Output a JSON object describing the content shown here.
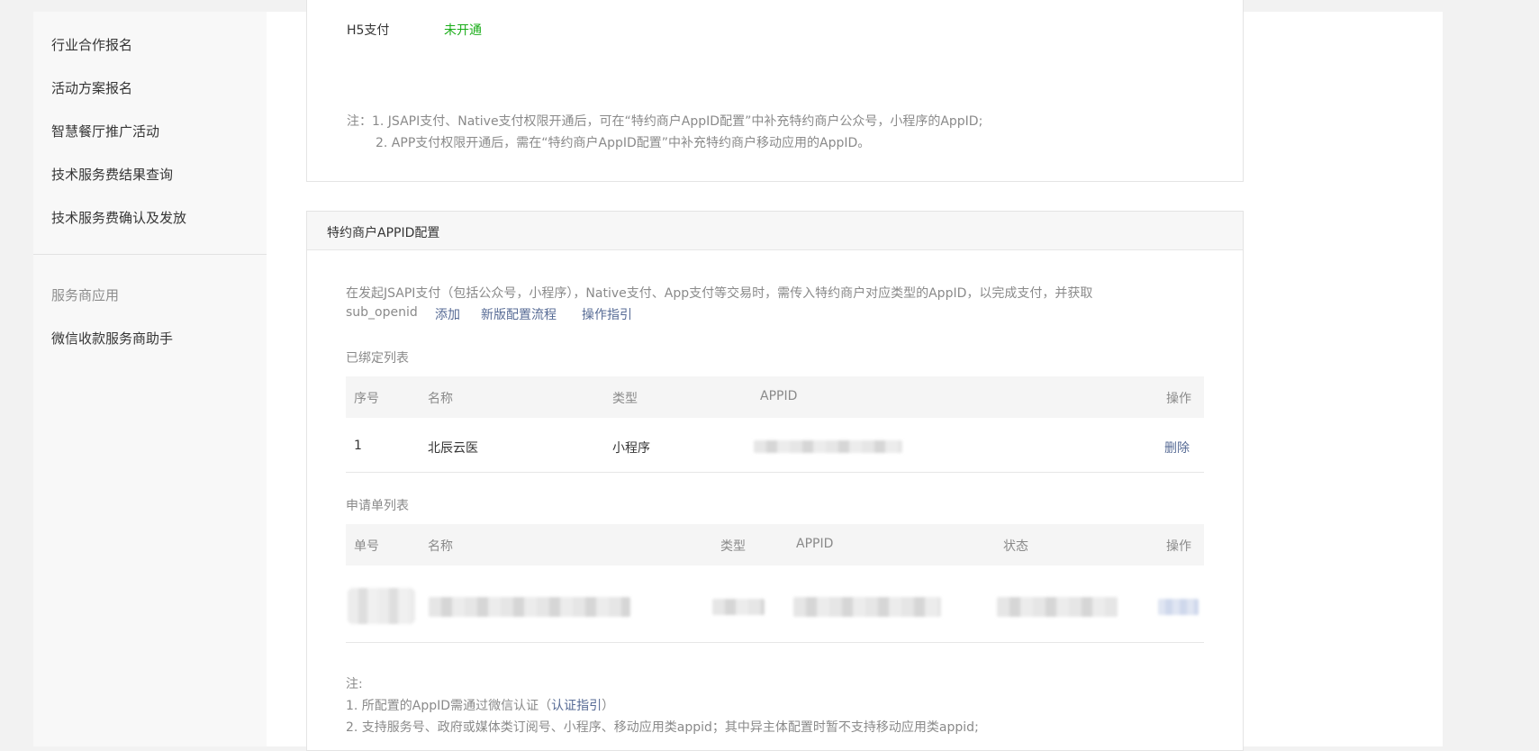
{
  "sidebar": {
    "items": [
      {
        "label": "行业合作报名"
      },
      {
        "label": "活动方案报名"
      },
      {
        "label": "智慧餐厅推广活动"
      },
      {
        "label": "技术服务费结果查询"
      },
      {
        "label": "技术服务费确认及发放"
      }
    ],
    "section_title": "服务商应用",
    "section_items": [
      {
        "label": "微信收款服务商助手"
      }
    ]
  },
  "payment_panel": {
    "h5_label": "H5支付",
    "h5_status": "未开通",
    "status_color": "#1aad19",
    "note_line1": "注：1. JSAPI支付、Native支付权限开通后，可在“特约商户AppID配置”中补充特约商户公众号，小程序的AppID;",
    "note_line2": "2. APP支付权限开通后，需在“特约商户AppID配置”中补充特约商户移动应用的AppID。"
  },
  "appid_panel": {
    "title": "特约商户APPID配置",
    "intro_line1": "在发起JSAPI支付（包括公众号，小程序），Native支付、App支付等交易时，需传入特约商户对应类型的AppID，以完成支付，并获取",
    "intro_line2": "sub_openid",
    "links": {
      "add": "添加",
      "new_flow": "新版配置流程",
      "guide": "操作指引"
    },
    "bound_list": {
      "title": "已绑定列表",
      "headers": [
        "序号",
        "名称",
        "类型",
        "APPID",
        "操作"
      ],
      "rows": [
        {
          "index": "1",
          "name": "北辰云医",
          "type": "小程序",
          "appid": "",
          "action": "删除"
        }
      ]
    },
    "apply_list": {
      "title": "申请单列表",
      "headers": [
        "单号",
        "名称",
        "类型",
        "APPID",
        "状态",
        "操作"
      ]
    },
    "notes": {
      "title": "注:",
      "line1_prefix": "1. 所配置的AppID需通过微信认证（",
      "line1_link": "认证指引",
      "line1_suffix": "）",
      "line2": "2. 支持服务号、政府或媒体类订阅号、小程序、移动应用类appid；其中异主体配置时暂不支持移动应用类appid;"
    }
  }
}
